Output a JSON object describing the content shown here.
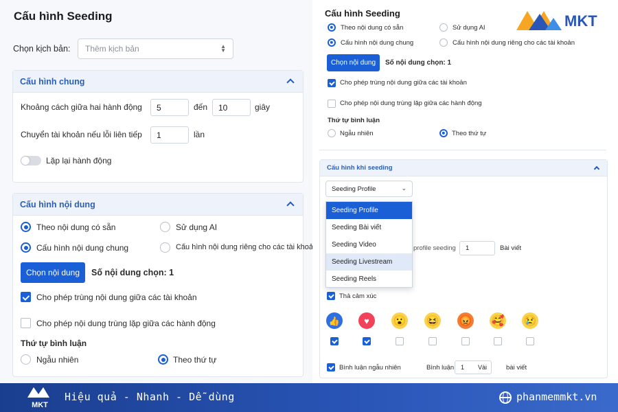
{
  "left": {
    "title": "Cấu hình Seeding",
    "scenario_label": "Chọn kịch bản:",
    "scenario_placeholder": "Thêm kịch bản",
    "general": {
      "header": "Cấu hình chung",
      "gap_label": "Khoảng cách giữa hai hành động",
      "gap_from": "5",
      "gap_to_label": "đến",
      "gap_to": "10",
      "gap_unit": "giây",
      "switch_label": "Chuyển tài khoản nếu lỗi liên tiếp",
      "switch_value": "1",
      "switch_unit": "lần",
      "repeat_label": "Lặp lại hành động"
    },
    "content": {
      "header": "Cấu hình nội dung",
      "opt_available": "Theo nội dung có sẵn",
      "opt_ai": "Sử dụng AI",
      "opt_common": "Cấu hình nội dung chung",
      "opt_private": "Cấu hình nội dung riêng cho các tài khoản",
      "choose_button": "Chọn nội dung",
      "count_label": "Số nội dung chọn: 1",
      "allow_dup_accounts": "Cho phép trùng nội dung giữa các tài khoản",
      "allow_dup_actions": "Cho phép nội dung trùng lặp giữa các hành động",
      "order_title": "Thứ tự bình luận",
      "order_random": "Ngẫu nhiên",
      "order_sequential": "Theo thứ tự"
    }
  },
  "right": {
    "title": "Cấu hình Seeding",
    "opt_available": "Theo nội dung có sẵn",
    "opt_ai": "Sử dụng AI",
    "opt_common": "Cấu hình nội dung chung",
    "opt_private": "Cấu hình nội dung riêng cho các tài khoản",
    "choose_button": "Chọn nội dung",
    "count_label": "Số nội dung chọn: 1",
    "allow_dup_accounts": "Cho phép trùng nội dung giữa các tài khoản",
    "allow_dup_actions": "Cho phép nội dung trùng lặp giữa các hành động",
    "order_title": "Thứ tự bình luận",
    "order_random": "Ngẫu nhiên",
    "order_sequential": "Theo thứ tự",
    "when_seeding": {
      "header": "Cấu hình khi seeding",
      "selected": "Seeding Profile",
      "options": [
        "Seeding Profile",
        "Seeding Bài viết",
        "Seeding Video",
        "Seeding Livestream",
        "Seeding Reels"
      ],
      "profile_label": "profile seeding",
      "profile_value": "1",
      "profile_unit": "Bài viết",
      "react_label": "Thả cảm xúc",
      "reactions": [
        {
          "name": "like",
          "checked": true
        },
        {
          "name": "love",
          "checked": true
        },
        {
          "name": "wow",
          "checked": false
        },
        {
          "name": "haha",
          "checked": false
        },
        {
          "name": "angry",
          "checked": false
        },
        {
          "name": "care",
          "checked": false
        },
        {
          "name": "sad",
          "checked": false
        }
      ],
      "random_comment": "Bình luận ngẫu nhiên",
      "comment_label": "Bình luận",
      "comment_value": "1",
      "comment_unit_short": "Vài",
      "comment_unit": "bài viết"
    }
  },
  "brand": {
    "name": "MKT"
  },
  "footer": {
    "slogan": "Hiệu quả - Nhanh - Dễ dùng",
    "website": "phanmemmkt.vn",
    "logo_text": "MKT"
  },
  "colors": {
    "accent": "#1a5fd6",
    "footer": "#2a56b8",
    "header_bg": "#eef3fb"
  }
}
